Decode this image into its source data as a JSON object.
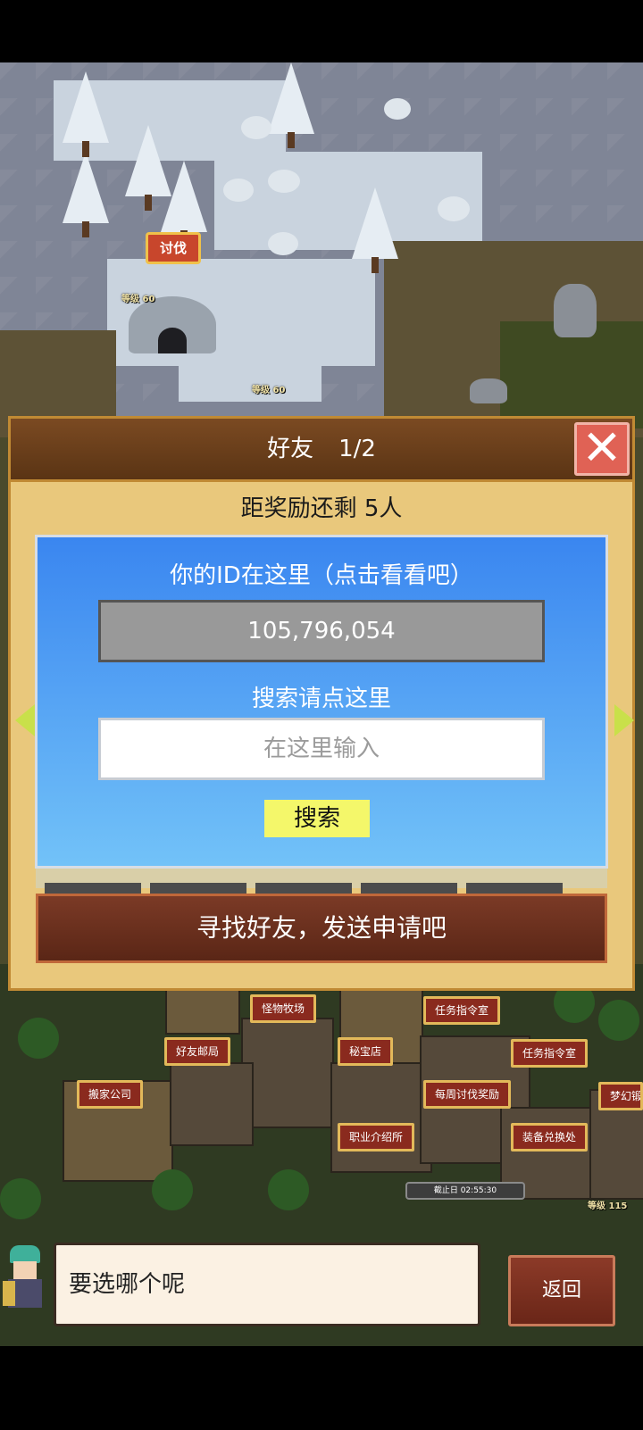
{
  "map": {
    "battle_tag": "讨伐",
    "level_label_1": "等级 60",
    "level_label_2": "等级 60",
    "level_label_3": "等级 115",
    "buildings": [
      "怪物牧场",
      "任务指令室",
      "好友邮局",
      "秘宝店",
      "任务指令室",
      "搬家公司",
      "每周讨伐奖励",
      "梦幻锻",
      "职业介绍所",
      "装备兑换处"
    ],
    "deadline": "截止日 02:55:30"
  },
  "dialog": {
    "title": "好友",
    "page": "1/2",
    "close_icon": "✕",
    "reward_text": "距奖励还剩 5人",
    "id_hint": "你的ID在这里（点击看看吧）",
    "id_value": "105,796,054",
    "search_hint": "搜索请点这里",
    "search_placeholder": "在这里输入",
    "search_button": "搜索",
    "find_friend_button": "寻找好友，发送申请吧"
  },
  "bottom": {
    "speech_text": "要选哪个呢",
    "back_button": "返回"
  },
  "colors": {
    "panel_blue_top": "#3a86f0",
    "panel_blue_bottom": "#72c2f8",
    "dialog_gold": "#e9c87c",
    "close_red": "#e06255",
    "search_yellow": "#f4f76a",
    "button_brown": "#6a2a18"
  }
}
